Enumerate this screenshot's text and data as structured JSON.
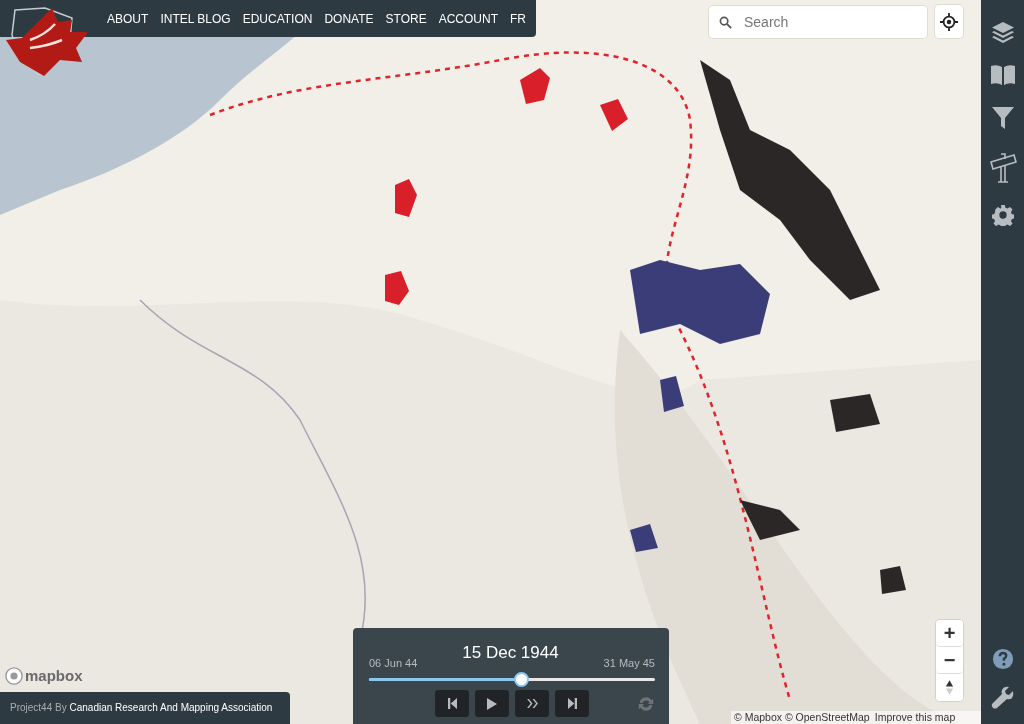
{
  "nav": {
    "items": [
      {
        "label": "ABOUT"
      },
      {
        "label": "INTEL BLOG"
      },
      {
        "label": "EDUCATION"
      },
      {
        "label": "DONATE"
      },
      {
        "label": "STORE"
      },
      {
        "label": "ACCOUNT"
      },
      {
        "label": "FR"
      }
    ]
  },
  "search": {
    "placeholder": "Search"
  },
  "zoom_controls": {
    "zoom_in": "+",
    "zoom_out": "−"
  },
  "timeline": {
    "current_date": "15 Dec 1944",
    "start_date": "06 Jun 44",
    "end_date": "31 May 45",
    "level": 0.53
  },
  "mapbox_logo": "mapbox",
  "credit": "Project44 By **Canadian Research And Mapping Association**",
  "attribution": {
    "text": "© Mapbox © OpenStreetMap",
    "link": "Improve this map"
  }
}
